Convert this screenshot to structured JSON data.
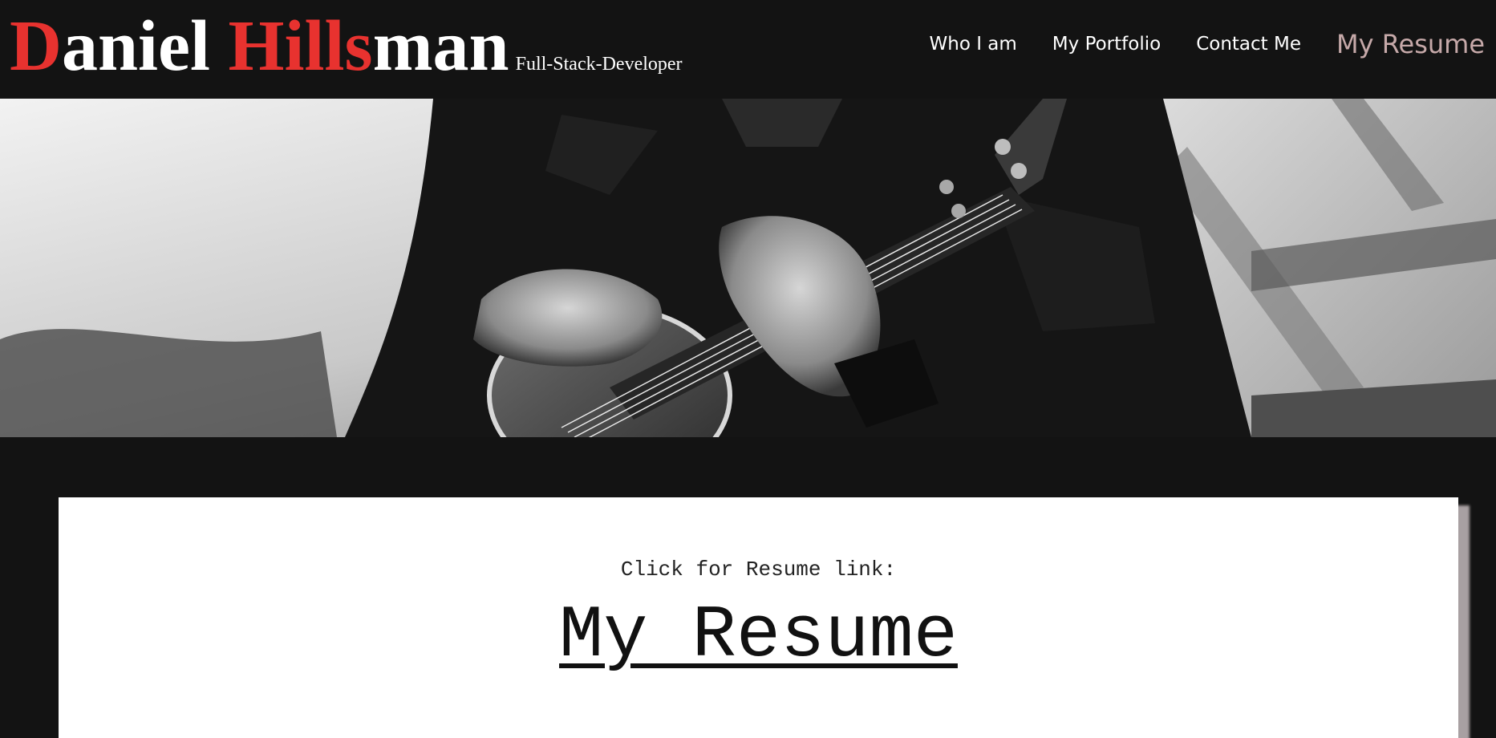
{
  "brand": {
    "name_parts": [
      {
        "text": "D",
        "accent": true
      },
      {
        "text": "aniel ",
        "accent": false
      },
      {
        "text": "Hills",
        "accent": true
      },
      {
        "text": "man",
        "accent": false
      }
    ],
    "tagline": "Full-Stack-Developer",
    "accent_color": "#e8322f"
  },
  "nav": {
    "items": [
      {
        "label": "Who I am",
        "active": false
      },
      {
        "label": "My Portfolio",
        "active": false
      },
      {
        "label": "Contact Me",
        "active": false
      },
      {
        "label": "My Resume",
        "active": true
      }
    ],
    "active_color": "#c6a9a9"
  },
  "hero": {
    "image_description_icon": "ukulele-player-photo"
  },
  "resume_card": {
    "label": "Click for Resume link:",
    "link_text": "My Resume"
  },
  "colors": {
    "page_background": "#131313",
    "card_background": "#ffffff",
    "card_shadow": "#a8a0a2"
  }
}
